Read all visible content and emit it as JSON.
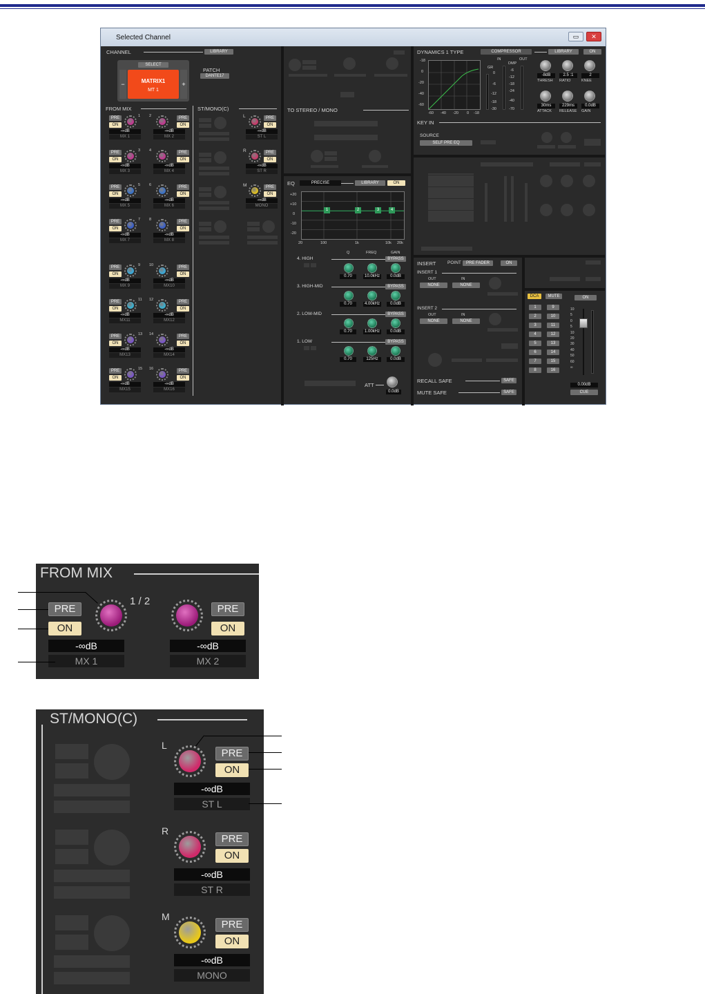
{
  "window": {
    "title": "Selected Channel",
    "min": "▭",
    "close": "✕"
  },
  "channel": {
    "title": "CHANNEL",
    "library": "LIBRARY",
    "select": "SELECT",
    "name": "MATRIX1",
    "id": "MT 1",
    "minus": "−",
    "plus": "+",
    "patch_label": "PATCH",
    "patch": "DANTE17"
  },
  "from_mix": {
    "title": "FROM MIX",
    "sends": [
      {
        "n": "1",
        "level": "-∞dB",
        "name": "MX 1",
        "color": "#c0388f"
      },
      {
        "n": "2",
        "level": "-∞dB",
        "name": "MX 2",
        "color": "#c0388f"
      },
      {
        "n": "3",
        "level": "-∞dB",
        "name": "MX 3",
        "color": "#c0388f"
      },
      {
        "n": "4",
        "level": "-∞dB",
        "name": "MX 4",
        "color": "#c0388f"
      },
      {
        "n": "5",
        "level": "-∞dB",
        "name": "MX 5",
        "color": "#3a72c8"
      },
      {
        "n": "6",
        "level": "-∞dB",
        "name": "MX 6",
        "color": "#3a72c8"
      },
      {
        "n": "7",
        "level": "-∞dB",
        "name": "MX 7",
        "color": "#3a5fc8"
      },
      {
        "n": "8",
        "level": "-∞dB",
        "name": "MX 8",
        "color": "#3a5fc8"
      },
      {
        "n": "9",
        "level": "-∞dB",
        "name": "MX 9",
        "color": "#39a8d8"
      },
      {
        "n": "10",
        "level": "-∞dB",
        "name": "MX10",
        "color": "#39a8d8"
      },
      {
        "n": "11",
        "level": "-∞dB",
        "name": "MX11",
        "color": "#39b0d0"
      },
      {
        "n": "12",
        "level": "-∞dB",
        "name": "MX12",
        "color": "#39b0d0"
      },
      {
        "n": "13",
        "level": "-∞dB",
        "name": "MX13",
        "color": "#7a55c8"
      },
      {
        "n": "14",
        "level": "-∞dB",
        "name": "MX14",
        "color": "#7a55c8"
      },
      {
        "n": "15",
        "level": "-∞dB",
        "name": "MX15",
        "color": "#7a55c8"
      },
      {
        "n": "16",
        "level": "-∞dB",
        "name": "MX16",
        "color": "#7a55c8"
      }
    ],
    "pre": "PRE",
    "on": "ON"
  },
  "st_mono": {
    "title": "ST/MONO(C)",
    "sends": [
      {
        "n": "L",
        "level": "-∞dB",
        "name": "ST L",
        "color": "#c83a6a"
      },
      {
        "n": "R",
        "level": "-∞dB",
        "name": "ST R",
        "color": "#c83a6a"
      },
      {
        "n": "M",
        "level": "-∞dB",
        "name": "MONO",
        "color": "#e0c020"
      }
    ]
  },
  "to_stereo": {
    "title": "TO STEREO / MONO"
  },
  "eq": {
    "title": "EQ",
    "mode": "PRECISE",
    "library": "LIBRARY",
    "on": "ON",
    "y_ticks": [
      "+20",
      "+10",
      "0",
      "-10",
      "-20"
    ],
    "x_ticks": [
      "20",
      "100",
      "1k",
      "10k",
      "20k"
    ],
    "markers": [
      "1",
      "2",
      "3",
      "4"
    ],
    "col_q": "Q",
    "col_freq": "FREQ",
    "col_gain": "GAIN",
    "bypass": "BYPASS",
    "bands": [
      {
        "name": "4. HIGH",
        "q": "0.70",
        "freq": "10.0kHz",
        "gain": "0.0dB"
      },
      {
        "name": "3. HIGH-MID",
        "q": "0.70",
        "freq": "4.00kHz",
        "gain": "0.0dB"
      },
      {
        "name": "2. LOW-MID",
        "q": "0.70",
        "freq": "1.00kHz",
        "gain": "0.0dB"
      },
      {
        "name": "1. LOW",
        "q": "0.70",
        "freq": "125Hz",
        "gain": "0.0dB"
      }
    ],
    "att_label": "ATT",
    "att": "0.0dB"
  },
  "dynamics": {
    "title": "DYNAMICS 1 TYPE",
    "type": "COMPRESSOR",
    "library": "LIBRARY",
    "on": "ON",
    "y_ticks": [
      "-18",
      "0",
      "-20",
      "-40",
      "-60"
    ],
    "x_ticks": [
      "-60",
      "-40",
      "-20",
      "0",
      "-18"
    ],
    "gr_label": "GR",
    "in_label": "IN",
    "out_label": "OUT",
    "dmp": "DMP",
    "gr_ticks": [
      "0",
      "-6",
      "-12",
      "-18",
      "-30"
    ],
    "in_ticks": [
      "-6",
      "-12",
      "-18",
      "-24",
      "-40",
      "-70"
    ],
    "params": [
      {
        "label": "THRESH",
        "value": "-8dB"
      },
      {
        "label": "RATIO",
        "value": "2.5 :1"
      },
      {
        "label": "KNEE",
        "value": "2"
      },
      {
        "label": "ATTACK",
        "value": "30ms"
      },
      {
        "label": "RELEASE",
        "value": "229ms"
      },
      {
        "label": "GAIN",
        "value": "0.0dB"
      }
    ],
    "keyin": "KEY IN",
    "source_label": "SOURCE",
    "source": "SELF PRE EQ"
  },
  "insert": {
    "title": "INSERT",
    "point_label": "POINT",
    "point": "PRE FADER",
    "on": "ON",
    "i1": "INSERT 1",
    "i2": "INSERT 2",
    "out": "OUT",
    "in": "IN",
    "none": "NONE"
  },
  "safe": {
    "recall": "RECALL SAFE",
    "mute": "MUTE SAFE",
    "btn": "SAFE"
  },
  "dca": {
    "dca": "DCA",
    "mute": "MUTE",
    "left": [
      "1",
      "2",
      "3",
      "4",
      "5",
      "6",
      "7",
      "8"
    ],
    "right": [
      "9",
      "10",
      "11",
      "12",
      "13",
      "14",
      "15",
      "16"
    ]
  },
  "fader": {
    "on": "ON",
    "scale": [
      "10",
      "5",
      "0",
      "5",
      "10",
      "20",
      "30",
      "40",
      "50",
      "60",
      "∞"
    ],
    "value": "0.00dB",
    "cue": "CUE"
  },
  "zoom_mix": {
    "title": "FROM MIX",
    "label": "1 / 2",
    "pre": "PRE",
    "on": "ON",
    "a_level": "-∞dB",
    "a_name": "MX 1",
    "b_level": "-∞dB",
    "b_name": "MX 2"
  },
  "zoom_st": {
    "title": "ST/MONO(C)",
    "pre": "PRE",
    "on": "ON",
    "rows": [
      {
        "n": "L",
        "level": "-∞dB",
        "name": "ST L"
      },
      {
        "n": "R",
        "level": "-∞dB",
        "name": "ST R"
      },
      {
        "n": "M",
        "level": "-∞dB",
        "name": "MONO"
      }
    ]
  },
  "colors": {
    "accent_channel": "#f24a1a",
    "pre_on": "#f1e1b3",
    "eq_marker": "#2e9a5a",
    "dca_active": "#e8c040"
  }
}
